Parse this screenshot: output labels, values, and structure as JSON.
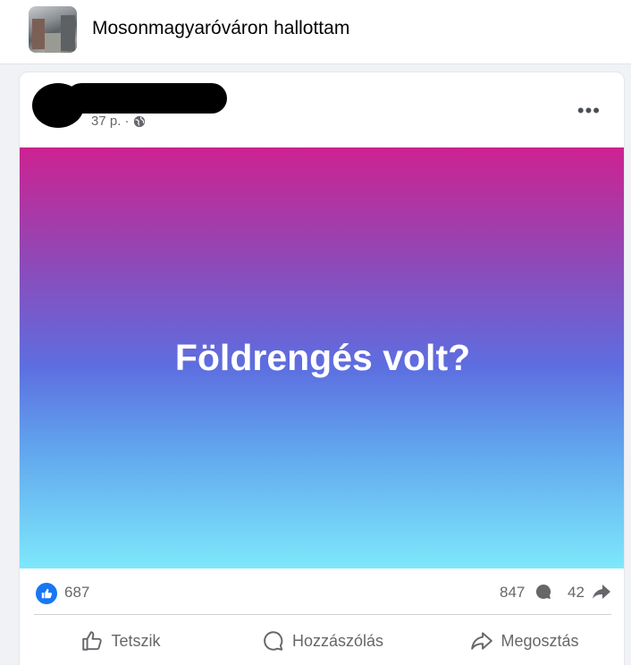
{
  "group": {
    "name": "Mosonmagyaróváron hallottam"
  },
  "post": {
    "time": "37 p. ·",
    "text": "Földrengés volt?",
    "background_gradient": [
      "#cd2290",
      "#5d6ee0",
      "#7ee8fb"
    ]
  },
  "stats": {
    "likes": "687",
    "comments": "847",
    "shares": "42"
  },
  "actions": {
    "like": "Tetszik",
    "comment": "Hozzászólás",
    "share": "Megosztás"
  },
  "colors": {
    "accent": "#1877f2",
    "muted": "#65676b"
  }
}
